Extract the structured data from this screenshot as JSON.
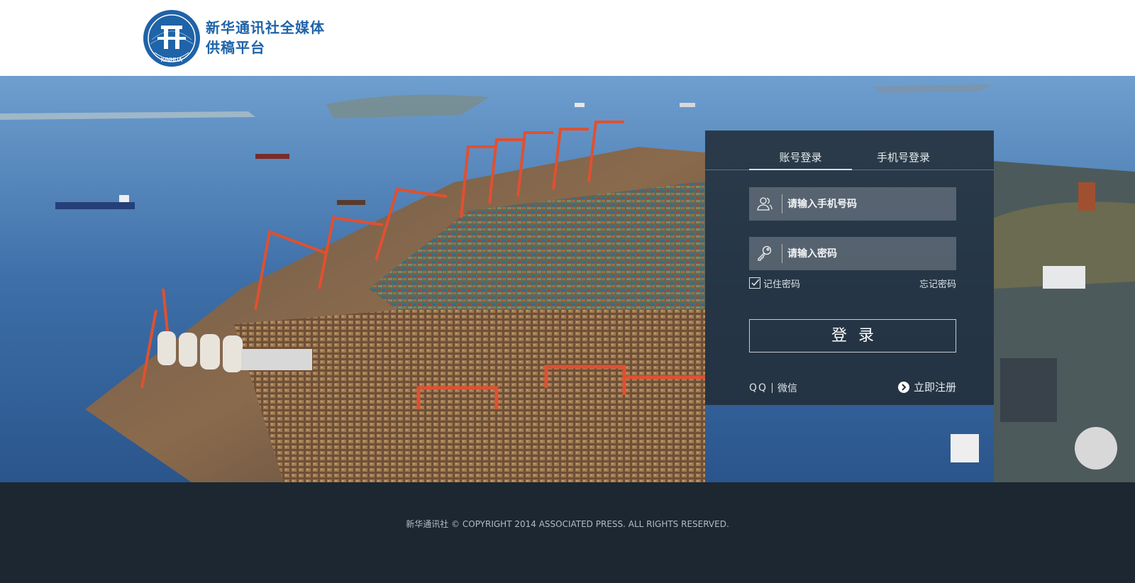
{
  "header": {
    "logo_line1": "新华通讯社全媒体",
    "logo_line2": "供稿平台",
    "emblem_label": "XINHUA"
  },
  "login": {
    "tabs": [
      {
        "label": "账号登录",
        "active": true
      },
      {
        "label": "手机号登录",
        "active": false
      }
    ],
    "phone_placeholder": "请输入手机号码",
    "password_placeholder": "请输入密码",
    "remember_label": "记住密码",
    "remember_checked": true,
    "forgot_label": "忘记密码",
    "submit_label": "登录",
    "social_qq": "QQ",
    "social_wechat": "微信",
    "register_label": "立即注册"
  },
  "footer": {
    "copyright": "新华通讯社 © COPYRIGHT 2014 ASSOCIATED PRESS. ALL RIGHTS RESERVED."
  },
  "colors": {
    "brand_blue": "#1f63a8",
    "footer_bg": "#1c2731",
    "panel_bg": "#222c35"
  },
  "icons": {
    "user": "users-icon",
    "key": "key-icon",
    "check": "checkbox-icon",
    "arrow": "arrow-right-circle-icon"
  }
}
